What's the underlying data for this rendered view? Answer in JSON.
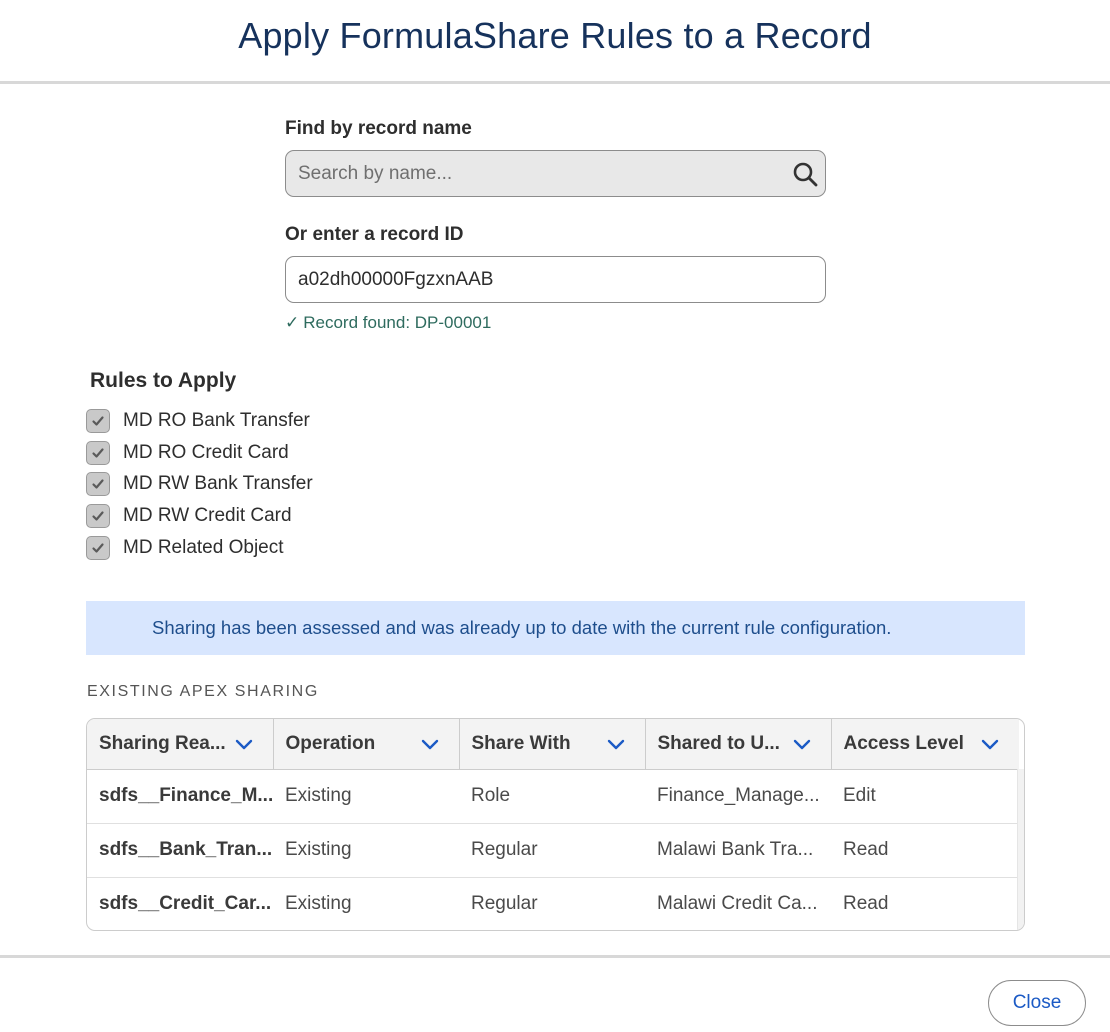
{
  "header": {
    "title": "Apply FormulaShare Rules to a Record"
  },
  "search": {
    "label": "Find by record name",
    "placeholder": "Search by name...",
    "icon": "search-icon"
  },
  "record_id": {
    "label": "Or enter a record ID",
    "value": "a02dh00000FgzxnAAB",
    "status_check": "✓",
    "status_text": "Record found: DP-00001"
  },
  "rules": {
    "title": "Rules to Apply",
    "items": [
      {
        "label": "MD RO Bank Transfer",
        "checked": true
      },
      {
        "label": "MD RO Credit Card",
        "checked": true
      },
      {
        "label": "MD RW Bank Transfer",
        "checked": true
      },
      {
        "label": "MD RW Credit Card",
        "checked": true
      },
      {
        "label": "MD Related Object",
        "checked": true
      }
    ]
  },
  "banner": {
    "text": "Sharing has been assessed and was already up to date with the current rule configuration."
  },
  "sharing_table": {
    "heading": "EXISTING APEX SHARING",
    "columns": [
      "Sharing Rea...",
      "Operation",
      "Share With",
      "Shared to U...",
      "Access Level"
    ],
    "rows": [
      [
        "sdfs__Finance_M...",
        "Existing",
        "Role",
        "Finance_Manage...",
        "Edit"
      ],
      [
        "sdfs__Bank_Tran...",
        "Existing",
        "Regular",
        "Malawi Bank Tra...",
        "Read"
      ],
      [
        "sdfs__Credit_Car...",
        "Existing",
        "Regular",
        "Malawi Credit Ca...",
        "Read"
      ]
    ]
  },
  "footer": {
    "close_label": "Close"
  },
  "colors": {
    "title": "#16325c",
    "accent": "#1b5ac5",
    "banner_bg": "#d8e6fe",
    "banner_text": "#1e4e8c",
    "success": "#2e6b5e"
  }
}
